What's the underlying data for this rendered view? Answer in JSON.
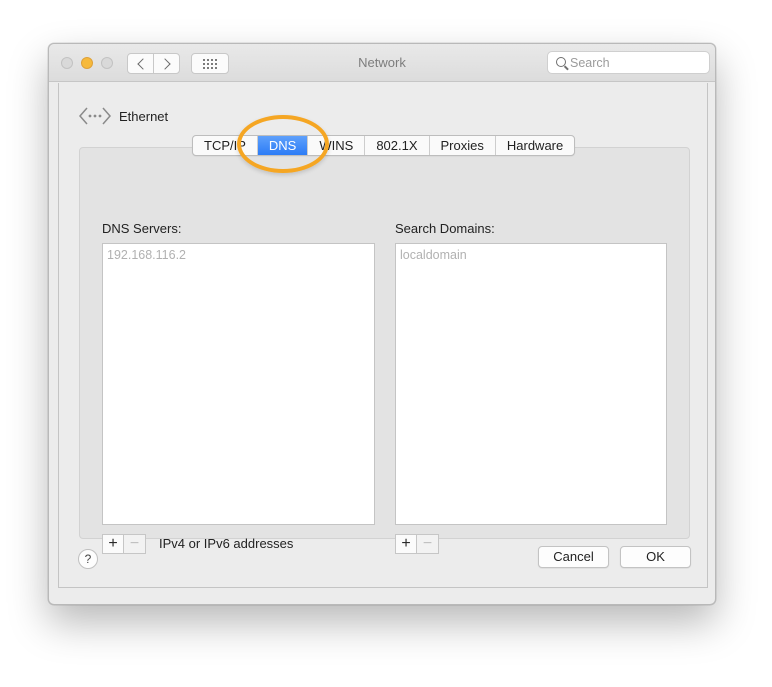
{
  "window": {
    "title": "Network",
    "search_placeholder": "Search"
  },
  "interface": {
    "name": "Ethernet",
    "icon": "ethernet-icon"
  },
  "tabs": [
    {
      "label": "TCP/IP",
      "active": false
    },
    {
      "label": "DNS",
      "active": true
    },
    {
      "label": "WINS",
      "active": false
    },
    {
      "label": "802.1X",
      "active": false
    },
    {
      "label": "Proxies",
      "active": false
    },
    {
      "label": "Hardware",
      "active": false
    }
  ],
  "dns_servers": {
    "label": "DNS Servers:",
    "entries": [
      "192.168.116.2"
    ],
    "hint": "IPv4 or IPv6 addresses"
  },
  "search_domains": {
    "label": "Search Domains:",
    "entries": [
      "localdomain"
    ]
  },
  "buttons": {
    "add": "+",
    "remove": "−",
    "help": "?",
    "cancel": "Cancel",
    "ok": "OK"
  },
  "colors": {
    "active_tab": "#2c7cf6",
    "highlight_ring": "#f5a623",
    "minimize_light": "#f6b93b"
  }
}
